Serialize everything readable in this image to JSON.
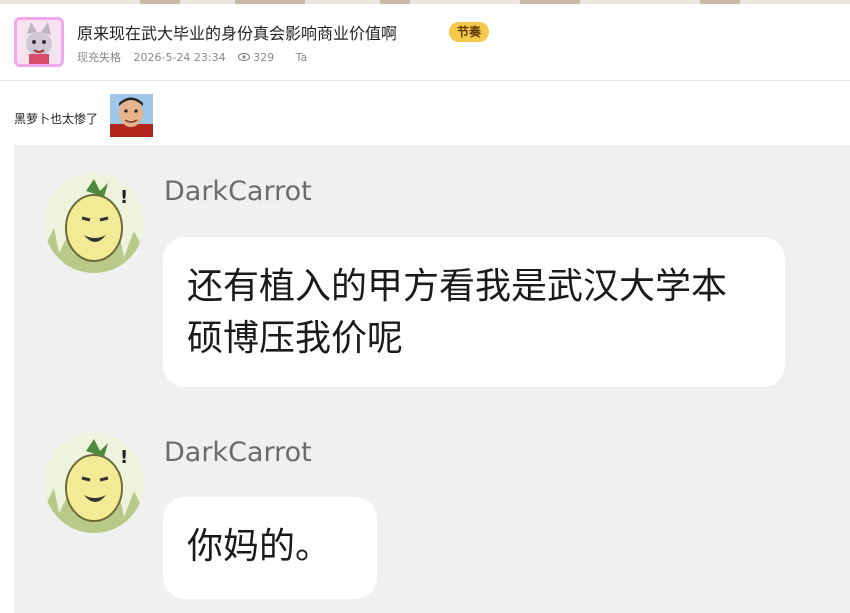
{
  "post": {
    "title": "原来现在武大毕业的身份真会影响商业价值啊",
    "tag": "节奏",
    "author": "现充失格",
    "datetime": "2026-5-24 23:34",
    "views": "329",
    "ta_label": "Ta"
  },
  "comment": {
    "text": "黑萝卜也太惨了"
  },
  "chat": {
    "messages": [
      {
        "username": "DarkCarrot",
        "text": "还有植入的甲方看我是武汉大学本硕博压我价呢"
      },
      {
        "username": "DarkCarrot",
        "text": "你妈的。"
      }
    ]
  },
  "colors": {
    "tag_bg": "#f5c84c",
    "avatar_border": "#f1a7ee",
    "chat_bg": "#f0f0f0"
  },
  "icons": [
    "user-avatar",
    "eye-icon",
    "meme-face-icon",
    "carrot-sticker-avatar"
  ]
}
